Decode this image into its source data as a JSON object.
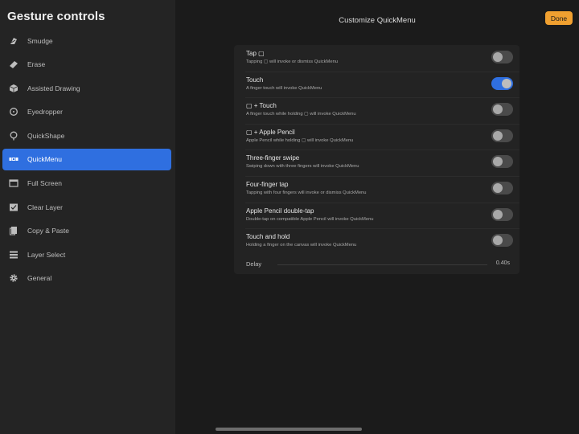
{
  "sidebar": {
    "title": "Gesture controls",
    "items": [
      {
        "label": "Smudge",
        "icon": "smudge-brush-icon"
      },
      {
        "label": "Erase",
        "icon": "eraser-icon"
      },
      {
        "label": "Assisted Drawing",
        "icon": "cube-icon"
      },
      {
        "label": "Eyedropper",
        "icon": "eyedropper-circle-icon"
      },
      {
        "label": "QuickShape",
        "icon": "quickshape-icon"
      },
      {
        "label": "QuickMenu",
        "icon": "quickmenu-icon",
        "active": true
      },
      {
        "label": "Full Screen",
        "icon": "full-screen-icon"
      },
      {
        "label": "Clear Layer",
        "icon": "clear-layer-icon"
      },
      {
        "label": "Copy & Paste",
        "icon": "copy-paste-icon"
      },
      {
        "label": "Layer Select",
        "icon": "layer-select-icon"
      },
      {
        "label": "General",
        "icon": "gear-icon"
      }
    ]
  },
  "header": {
    "title": "Customize QuickMenu",
    "done_label": "Done"
  },
  "settings": [
    {
      "title": "Tap ▢",
      "description": "Tapping ▢ will invoke or dismiss QuickMenu",
      "enabled": false
    },
    {
      "title": "Touch",
      "description": "A finger touch will invoke QuickMenu",
      "enabled": true
    },
    {
      "title": "▢ + Touch",
      "description": "A finger touch while holding ▢ will invoke QuickMenu",
      "enabled": false
    },
    {
      "title": "▢ + Apple Pencil",
      "description": "Apple Pencil while holding ▢ will invoke QuickMenu",
      "enabled": false
    },
    {
      "title": "Three-finger swipe",
      "description": "Swiping down with three fingers will invoke QuickMenu",
      "enabled": false
    },
    {
      "title": "Four-finger tap",
      "description": "Tapping with four fingers will invoke or dismiss QuickMenu",
      "enabled": false
    },
    {
      "title": "Apple Pencil double-tap",
      "description": "Double-tap on compatible Apple Pencil will invoke QuickMenu",
      "enabled": false
    },
    {
      "title": "Touch and hold",
      "description": "Holding a finger on the canvas will invoke QuickMenu",
      "enabled": false
    }
  ],
  "delay": {
    "label": "Delay",
    "value": "0.40s"
  },
  "colors": {
    "accent": "#2f6fe0",
    "done": "#f0a030",
    "background": "#1b1b1b",
    "sidebar": "#242424"
  }
}
